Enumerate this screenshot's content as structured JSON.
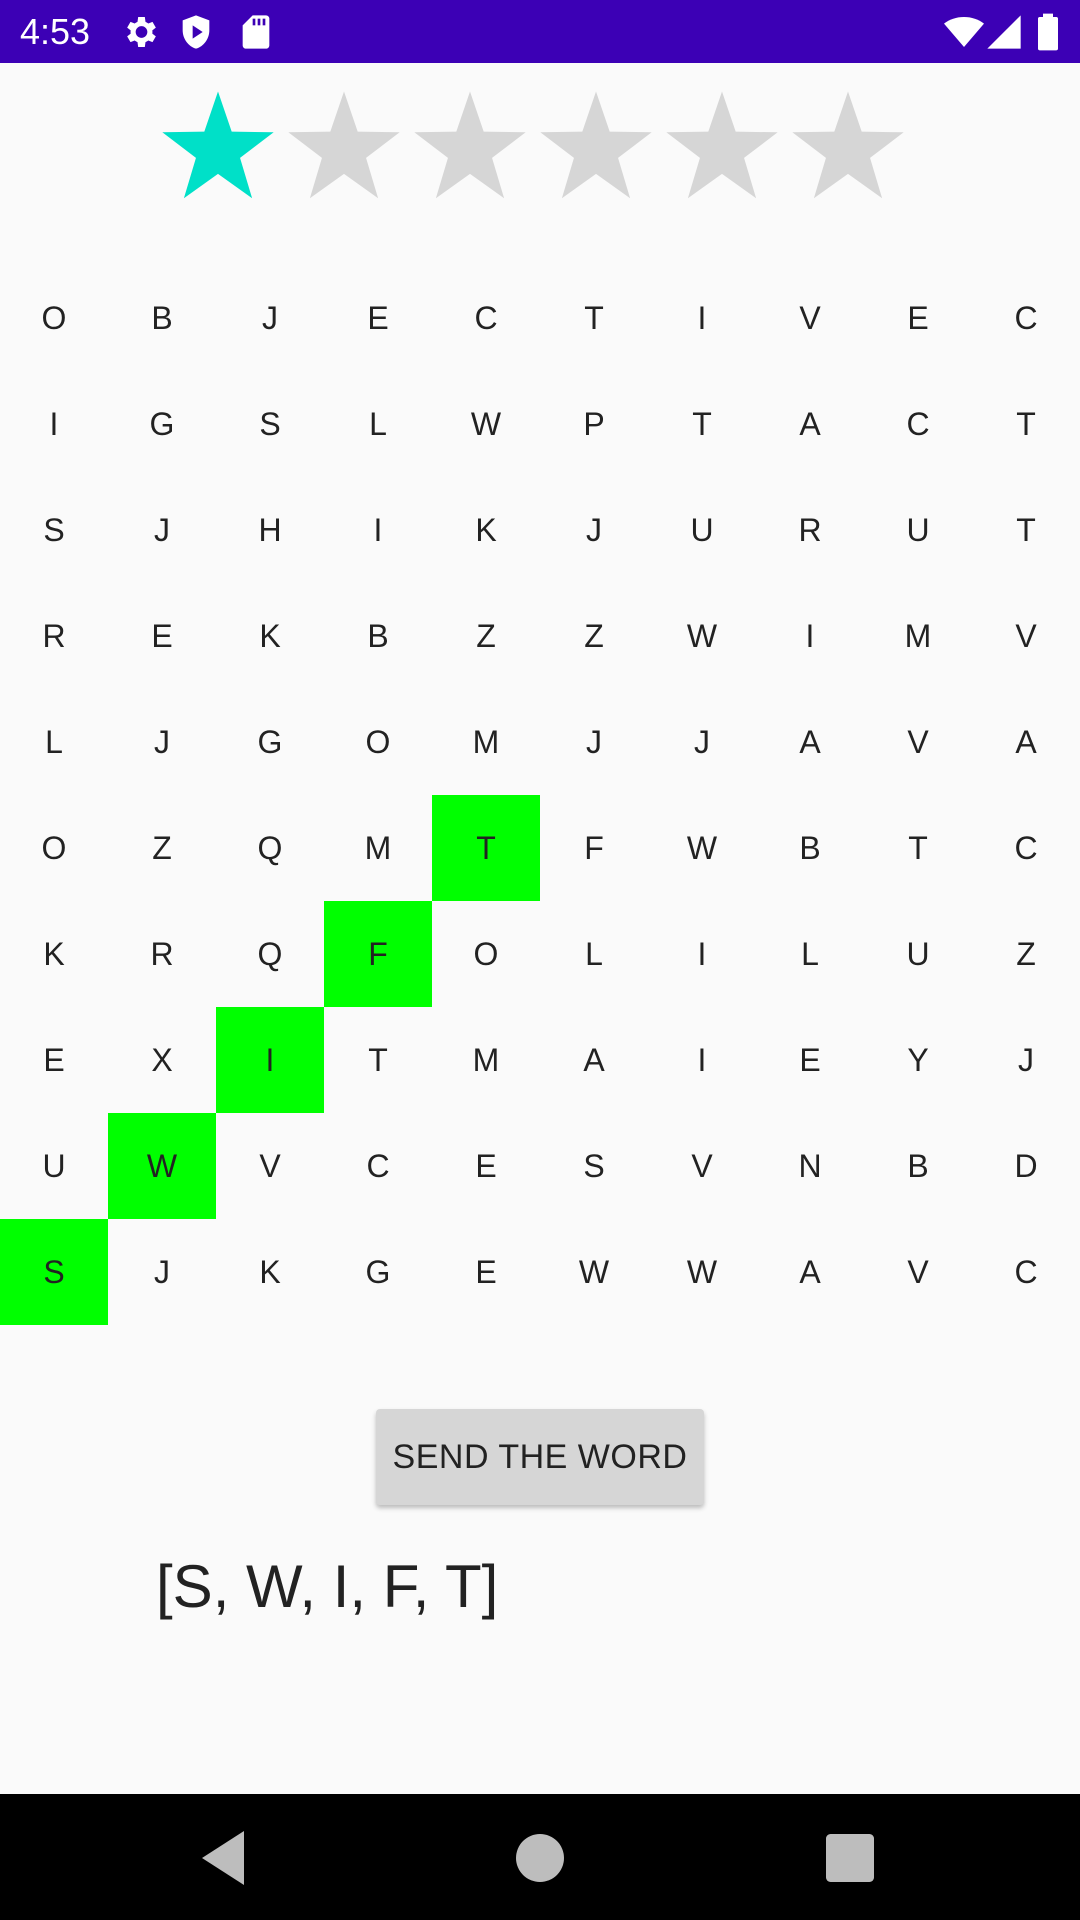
{
  "status_bar": {
    "time": "4:53",
    "icons_left": [
      "gear-icon",
      "shield-play-icon",
      "sd-card-icon"
    ],
    "icons_right": [
      "wifi-icon",
      "signal-icon",
      "battery-icon"
    ],
    "background": "#3c00b5"
  },
  "rating": {
    "total": 6,
    "filled": 1,
    "filled_color": "#00e0c8",
    "empty_color": "#d6d6d6"
  },
  "grid": {
    "highlight_color": "#00ff00",
    "rows": [
      [
        "O",
        "B",
        "J",
        "E",
        "C",
        "T",
        "I",
        "V",
        "E",
        "C"
      ],
      [
        "I",
        "G",
        "S",
        "L",
        "W",
        "P",
        "T",
        "A",
        "C",
        "T"
      ],
      [
        "S",
        "J",
        "H",
        "I",
        "K",
        "J",
        "U",
        "R",
        "U",
        "T"
      ],
      [
        "R",
        "E",
        "K",
        "B",
        "Z",
        "Z",
        "W",
        "I",
        "M",
        "V"
      ],
      [
        "L",
        "J",
        "G",
        "O",
        "M",
        "J",
        "J",
        "A",
        "V",
        "A"
      ],
      [
        "O",
        "Z",
        "Q",
        "M",
        "T",
        "F",
        "W",
        "B",
        "T",
        "C"
      ],
      [
        "K",
        "R",
        "Q",
        "F",
        "O",
        "L",
        "I",
        "L",
        "U",
        "Z"
      ],
      [
        "E",
        "X",
        "I",
        "T",
        "M",
        "A",
        "I",
        "E",
        "Y",
        "J"
      ],
      [
        "U",
        "W",
        "V",
        "C",
        "E",
        "S",
        "V",
        "N",
        "B",
        "D"
      ],
      [
        "S",
        "J",
        "K",
        "G",
        "E",
        "W",
        "W",
        "A",
        "V",
        "C"
      ]
    ],
    "highlighted": [
      [
        9,
        0
      ],
      [
        8,
        1
      ],
      [
        7,
        2
      ],
      [
        6,
        3
      ],
      [
        5,
        4
      ]
    ]
  },
  "actions": {
    "send_label": "SEND THE WORD"
  },
  "selection": {
    "text": "[S, W, I, F, T]"
  },
  "nav_bar": {
    "buttons": [
      "back-icon",
      "home-icon",
      "recents-icon"
    ]
  }
}
